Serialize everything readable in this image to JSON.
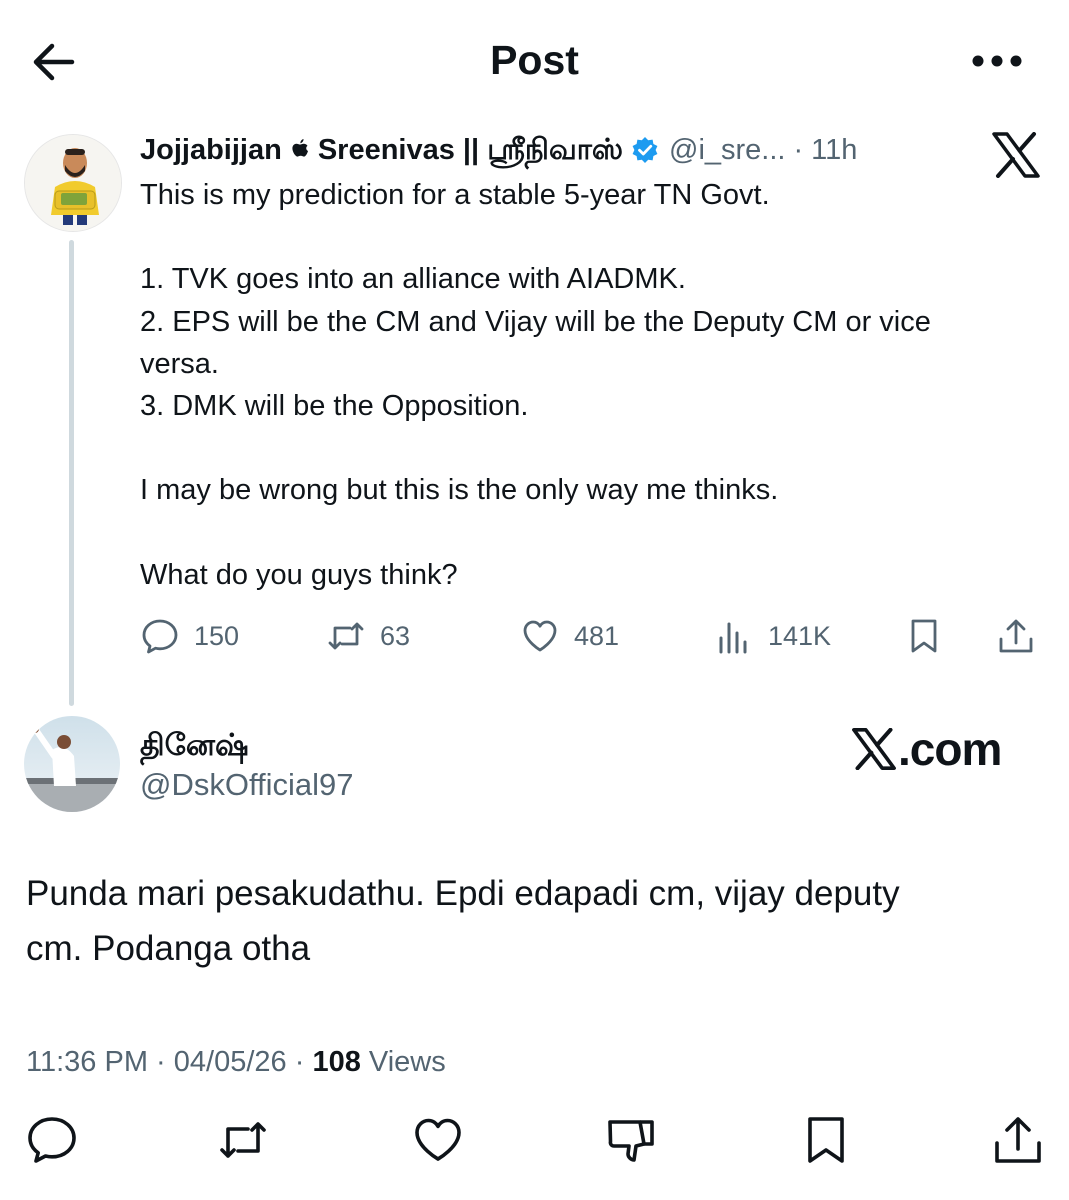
{
  "header": {
    "title": "Post",
    "back_icon": "arrow-left-icon",
    "more_icon": "more-horizontal-icon"
  },
  "parent_tweet": {
    "author_name_part1": "Jojjabijjan",
    "author_name_part2": "Sreenivas || ஸ்ரீநிவாஸ்",
    "apple_icon": "apple-logo-icon",
    "verified": true,
    "handle": "@i_sre...",
    "separator": "·",
    "age": "11h",
    "platform_icon": "x-logo-icon",
    "body_lines": [
      "This is my prediction for a stable 5-year TN Govt.",
      "",
      "1. TVK goes into an alliance with AIADMK.",
      "2. EPS will be the CM and Vijay will be the Deputy CM or vice",
      "versa.",
      "3. DMK will be the Opposition.",
      "",
      "I may be wrong but this is the only way me thinks.",
      "",
      "What do you guys think?"
    ],
    "stats": {
      "replies": "150",
      "retweets": "63",
      "likes": "481",
      "views": "141K"
    }
  },
  "reply_tweet": {
    "author_name": "தினேஷ்",
    "handle": "@DskOfficial97",
    "watermark": ".com",
    "body_line1": "Punda mari pesakudathu. Epdi edapadi cm, vijay deputy",
    "body_line2": "cm. Podanga otha",
    "time": "11:36 PM",
    "date": "04/05/26",
    "separator": "·",
    "views_count": "108",
    "views_label": "Views"
  },
  "bottom_actions": {
    "icons": [
      "reply-icon",
      "retweet-icon",
      "like-icon",
      "dislike-icon",
      "bookmark-icon",
      "share-icon"
    ]
  },
  "colors": {
    "text": "#0f1419",
    "secondary": "#536471",
    "verified": "#1d9bf0",
    "thread_line": "#cfd9de"
  }
}
